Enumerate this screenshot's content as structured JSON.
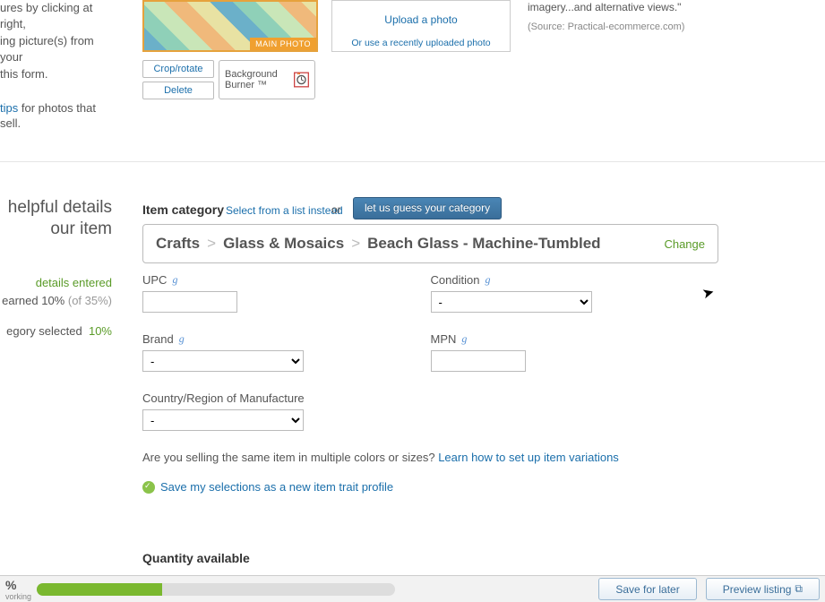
{
  "photos": {
    "helper_lines": [
      "ures by clicking at right,",
      "ing picture(s) from your",
      "this form."
    ],
    "tips_link": "tips",
    "tips_tail": " for photos that sell.",
    "main_photo_tag": "MAIN PHOTO",
    "crop_label": "Crop/rotate",
    "delete_label": "Delete",
    "bg_burner_label": "Background Burner ™",
    "upload_label": "Upload a photo",
    "upload_alt": "Or use a recently uploaded photo",
    "pro_quote": "imagery...and alternative views.\"",
    "pro_source": "(Source: Practical-ecommerce.com)"
  },
  "left_help": {
    "line1": "helpful details",
    "line2": "our item",
    "details_entered": "details entered",
    "earned_prefix": "earned 10% ",
    "earned_suffix": "(of 35%)",
    "category_selected": "egory selected",
    "category_pct": "10%"
  },
  "category": {
    "heading": "Item category",
    "select_list": "Select from a list instead",
    "or": "or",
    "guess_button": "let us guess your category",
    "crumbs": [
      "Crafts",
      "Glass & Mosaics",
      "Beach Glass - Machine-Tumbled"
    ],
    "change": "Change"
  },
  "fields": {
    "upc_label": "UPC",
    "condition_label": "Condition",
    "condition_value": "-",
    "brand_label": "Brand",
    "brand_value": "-",
    "mpn_label": "MPN",
    "country_label": "Country/Region of Manufacture",
    "country_value": "-"
  },
  "variations": {
    "question": "Are you selling the same item in multiple colors or sizes? ",
    "link": "Learn how to set up item variations"
  },
  "save_profile": "Save my selections as a new item trait profile",
  "quantity_heading": "Quantity available",
  "bottom_bar": {
    "percent": "%",
    "sub": "vorking",
    "progress_percent": 35,
    "save_label": "Save for later",
    "preview_label": "Preview listing"
  }
}
